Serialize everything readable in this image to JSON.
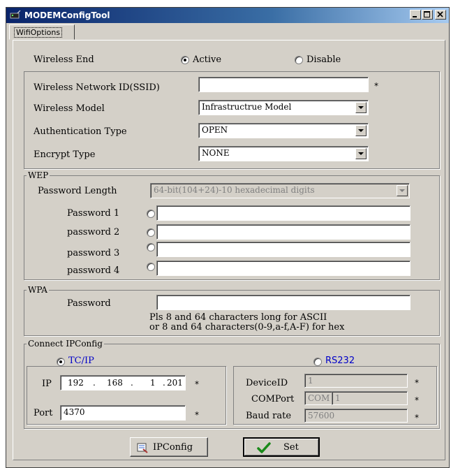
{
  "window": {
    "title": "MODEMConfigTool"
  },
  "tab": "WifiOptions",
  "wireless_end": {
    "label": "Wireless End",
    "active_label": "Active",
    "disable_label": "Disable",
    "selected": "Active"
  },
  "wifi": {
    "ssid_label": "Wireless Network ID(SSID)",
    "ssid_value": "",
    "required_mark": "*",
    "model_label": "Wireless Model",
    "model_value": "Infrastructrue Model",
    "auth_label": "Authentication Type",
    "auth_value": "OPEN",
    "encrypt_label": "Encrypt Type",
    "encrypt_value": "NONE"
  },
  "wep": {
    "title": "WEP",
    "pw_length_label": "Password Length",
    "pw_length_value": "64-bit(104+24)-10 hexadecimal digits",
    "passwords": [
      {
        "label": "Password 1",
        "value": ""
      },
      {
        "label": "password 2",
        "value": ""
      },
      {
        "label": "password 3",
        "value": ""
      },
      {
        "label": "password 4",
        "value": ""
      }
    ]
  },
  "wpa": {
    "title": "WPA",
    "password_label": "Password",
    "password_value": "",
    "hint_line1": "Pls 8 and 64 characters long for ASCII",
    "hint_line2": "or 8 and 64 characters(0-9,a-f,A-F) for hex"
  },
  "connect": {
    "title": "Connect IPConfig",
    "tcpip_label": "TC/IP",
    "rs232_label": "RS232",
    "selected": "TC/IP",
    "ip_label": "IP",
    "ip_octets": [
      "192",
      "168",
      "1",
      "201"
    ],
    "port_label": "Port",
    "port_value": "4370",
    "deviceid_label": "DeviceID",
    "deviceid_value": "1",
    "comport_label": "COMPort",
    "comport_prefix": "COM",
    "comport_value": "1",
    "baud_label": "Baud rate",
    "baud_value": "57600",
    "required_mark": "*"
  },
  "buttons": {
    "ipconfig_label": "IPConfig",
    "set_label": "Set"
  },
  "colors": {
    "accent_blue": "#0000c8",
    "title_bar": "#0a246a",
    "face": "#d4d0c8"
  }
}
